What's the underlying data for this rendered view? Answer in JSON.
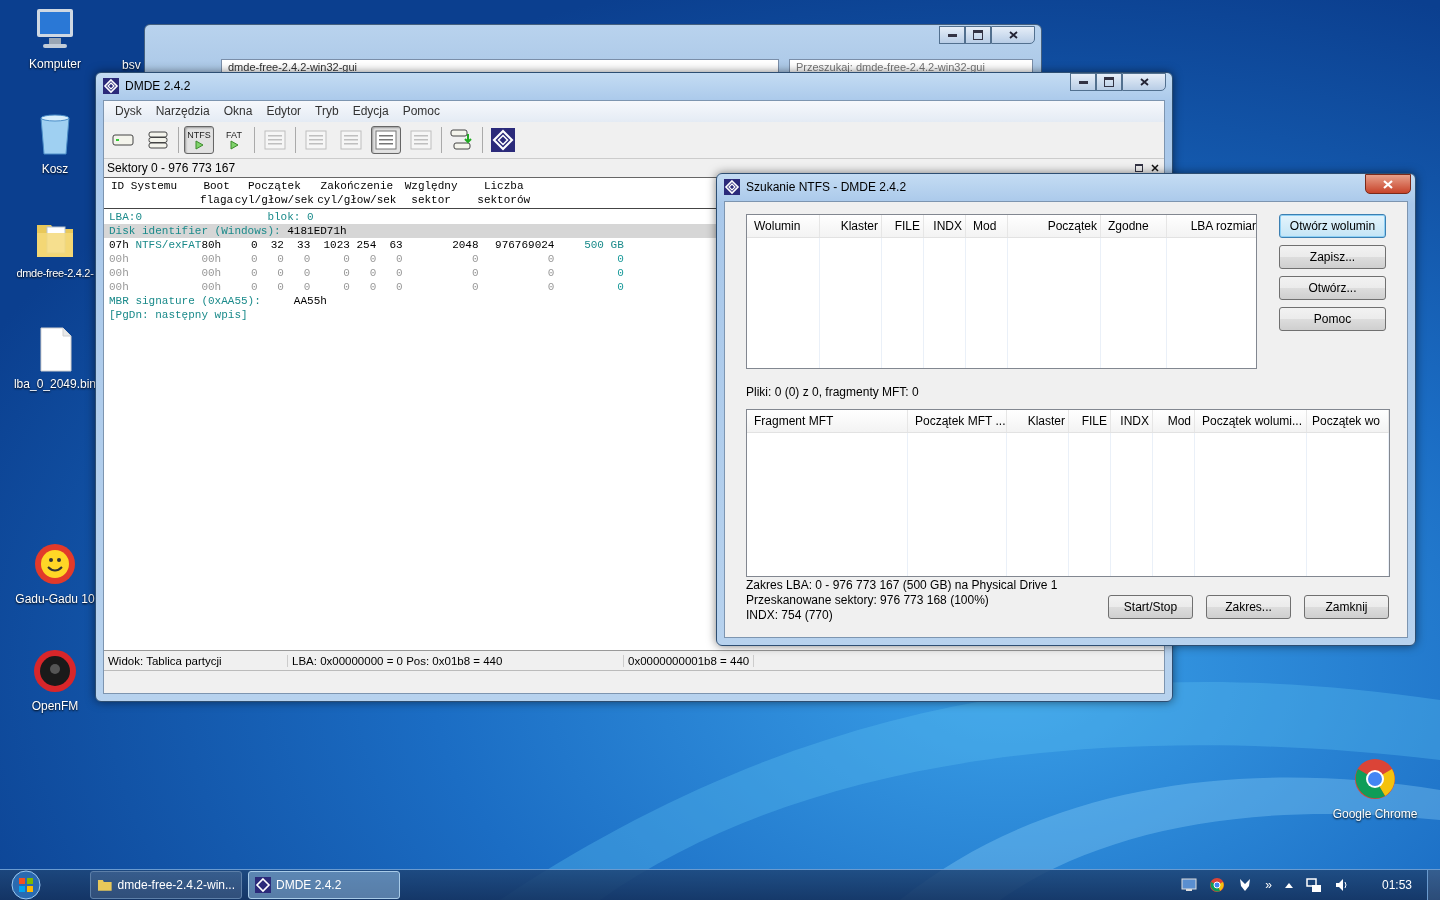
{
  "desktop_icons": [
    {
      "label": "Komputer",
      "kind": "computer"
    },
    {
      "label": "Kosz",
      "kind": "bin"
    },
    {
      "label": "dmde-free-2.4.2-",
      "kind": "folder"
    },
    {
      "label": "lba_0_2049.bin",
      "kind": "file"
    },
    {
      "label": "Gadu-Gadu 10",
      "kind": "sun"
    },
    {
      "label": "OpenFM",
      "kind": "speaker"
    },
    {
      "label": "Google Chrome",
      "kind": "chrome"
    },
    {
      "label": "bsv",
      "kind": "partial"
    }
  ],
  "background_window": {
    "breadcrumb": "dmde-free-2.4.2-win32-gui",
    "search_placeholder": "Przeszukaj: dmde-free-2.4.2-win32-gui"
  },
  "main_window": {
    "title": "DMDE 2.4.2",
    "menu": [
      "Dysk",
      "Narzędzia",
      "Okna",
      "Edytor",
      "Tryb",
      "Edycja",
      "Pomoc"
    ],
    "toolbar": [
      {
        "kind": "drive",
        "pressed": false,
        "disabled": false
      },
      {
        "kind": "stack",
        "pressed": false,
        "disabled": false
      },
      {
        "kind": "fs",
        "label": "NTFS",
        "pressed": true,
        "disabled": false
      },
      {
        "kind": "fs",
        "label": "FAT",
        "pressed": false,
        "disabled": false
      },
      {
        "kind": "new",
        "pressed": false,
        "disabled": true
      },
      {
        "kind": "tree",
        "pressed": false,
        "disabled": true
      },
      {
        "kind": "list",
        "pressed": false,
        "disabled": true
      },
      {
        "kind": "details",
        "pressed": true,
        "disabled": false
      },
      {
        "kind": "find",
        "pressed": false,
        "disabled": true
      },
      {
        "kind": "copy",
        "pressed": false,
        "disabled": false
      },
      {
        "kind": "logo",
        "pressed": false,
        "disabled": false
      }
    ],
    "range": "Sektory 0 - 976 773 167",
    "table": {
      "header": [
        [
          "ID Systemu"
        ],
        [
          "Boot",
          "flaga"
        ],
        [
          "Początek",
          "cyl/głow/sek"
        ],
        [
          "Zakończenie",
          "cyl/głow/sek"
        ],
        [
          "Względny",
          "sektor"
        ],
        [
          "Liczba",
          "sektorów"
        ]
      ],
      "lba_line": {
        "label": "LBA:0",
        "block": "blok: 0"
      },
      "disk_id": {
        "label": "Disk identifier (Windows):",
        "value": "4181ED71h"
      },
      "rows": [
        {
          "empty": false,
          "cells": [
            "07h",
            "NTFS/exFAT",
            "80h",
            "0",
            "32",
            "33",
            "1023",
            "254",
            "63",
            "2048",
            "976769024",
            "500 GB"
          ]
        },
        {
          "empty": true,
          "cells": [
            "00h",
            "",
            "00h",
            "0",
            "0",
            "0",
            "0",
            "0",
            "0",
            "0",
            "0",
            "0"
          ]
        },
        {
          "empty": true,
          "cells": [
            "00h",
            "",
            "00h",
            "0",
            "0",
            "0",
            "0",
            "0",
            "0",
            "0",
            "0",
            "0"
          ]
        },
        {
          "empty": true,
          "cells": [
            "00h",
            "",
            "00h",
            "0",
            "0",
            "0",
            "0",
            "0",
            "0",
            "0",
            "0",
            "0"
          ]
        }
      ],
      "signature": {
        "label": "MBR signature (0xAA55):",
        "value": "AA55h"
      },
      "hint": "[PgDn: następny wpis]"
    },
    "status_bar": [
      "Widok: Tablica partycji",
      "LBA: 0x00000000 = 0  Pos: 0x01b8 = 440",
      "0x0000000001b8 = 440"
    ]
  },
  "dialog": {
    "title": "Szukanie NTFS - DMDE 2.4.2",
    "volumes_table": {
      "columns": [
        "Wolumin",
        "Klaster",
        "FILE",
        "INDX",
        "Mod",
        "Początek",
        "Zgodne",
        "LBA rozmiar"
      ]
    },
    "side_buttons": [
      {
        "label": "Otwórz wolumin",
        "selected": true
      },
      {
        "label": "Zapisz...",
        "selected": false
      },
      {
        "label": "Otwórz...",
        "selected": false
      },
      {
        "label": "Pomoc",
        "selected": false
      }
    ],
    "files_info": "Pliki: 0 (0) z 0, fragmenty MFT: 0",
    "fragments_table": {
      "columns": [
        "Fragment MFT",
        "Początek MFT ...",
        "Klaster",
        "FILE",
        "INDX",
        "Mod",
        "Początek wolumi...",
        "Początek wo"
      ]
    },
    "info_lines": [
      "Zakres LBA: 0 - 976 773 167 (500 GB) na Physical Drive 1",
      "Przeskanowane sektory: 976 773 168 (100%)",
      "INDX: 754 (770)"
    ],
    "bottom_buttons": [
      "Start/Stop",
      "Zakres...",
      "Zamknij"
    ]
  },
  "taskbar": {
    "tasks": [
      {
        "kind": "folder",
        "label": "dmde-free-2.4.2-win...",
        "selected": false
      },
      {
        "kind": "dmde",
        "label": "DMDE 2.4.2",
        "selected": true
      }
    ],
    "overflow": "»",
    "clock": "01:53"
  }
}
